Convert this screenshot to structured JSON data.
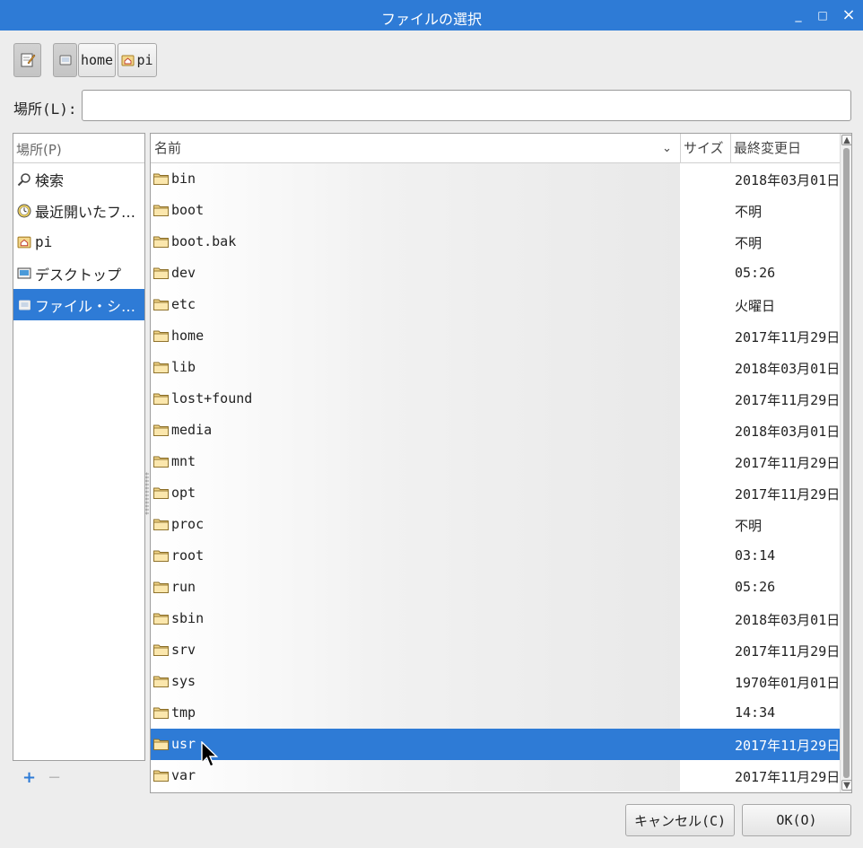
{
  "window": {
    "title": "ファイルの選択",
    "controls": {
      "minimize": "_",
      "maximize": "□",
      "close": "×"
    }
  },
  "pathbar": {
    "edit_icon": "pencil-icon",
    "segments": [
      {
        "label": "",
        "icon": "filesystem-icon"
      },
      {
        "label": "home",
        "icon": ""
      },
      {
        "label": "pi",
        "icon": "home-folder-icon"
      }
    ]
  },
  "location": {
    "label": "場所(L):",
    "value": "",
    "placeholder": ""
  },
  "places": {
    "header": "場所(P)",
    "items": [
      {
        "label": "検索",
        "icon": "search-icon"
      },
      {
        "label": "最近開いたフ…",
        "icon": "recent-clock-icon"
      },
      {
        "label": "pi",
        "icon": "home-folder-icon"
      },
      {
        "label": "デスクトップ",
        "icon": "desktop-icon"
      },
      {
        "label": "ファイル・シ…",
        "icon": "filesystem-icon",
        "selected": true
      }
    ],
    "add_label": "+",
    "remove_label": "−"
  },
  "files": {
    "columns": {
      "name": "名前",
      "size": "サイズ",
      "modified": "最終変更日",
      "sort_indicator": "⌄"
    },
    "rows": [
      {
        "name": "bin",
        "modified": "2018年03月01日"
      },
      {
        "name": "boot",
        "modified": "不明"
      },
      {
        "name": "boot.bak",
        "modified": "不明"
      },
      {
        "name": "dev",
        "modified": "05:26"
      },
      {
        "name": "etc",
        "modified": "火曜日"
      },
      {
        "name": "home",
        "modified": "2017年11月29日"
      },
      {
        "name": "lib",
        "modified": "2018年03月01日"
      },
      {
        "name": "lost+found",
        "modified": "2017年11月29日"
      },
      {
        "name": "media",
        "modified": "2018年03月01日"
      },
      {
        "name": "mnt",
        "modified": "2017年11月29日"
      },
      {
        "name": "opt",
        "modified": "2017年11月29日"
      },
      {
        "name": "proc",
        "modified": "不明"
      },
      {
        "name": "root",
        "modified": "03:14"
      },
      {
        "name": "run",
        "modified": "05:26"
      },
      {
        "name": "sbin",
        "modified": "2018年03月01日"
      },
      {
        "name": "srv",
        "modified": "2017年11月29日"
      },
      {
        "name": "sys",
        "modified": "1970年01月01日"
      },
      {
        "name": "tmp",
        "modified": "14:34"
      },
      {
        "name": "usr",
        "modified": "2017年11月29日",
        "selected": true
      },
      {
        "name": "var",
        "modified": "2017年11月29日"
      }
    ]
  },
  "buttons": {
    "cancel": "キャンセル(C)",
    "ok": "OK(O)"
  },
  "colors": {
    "accent": "#2e7bd6",
    "folder": "#f3d78a"
  }
}
